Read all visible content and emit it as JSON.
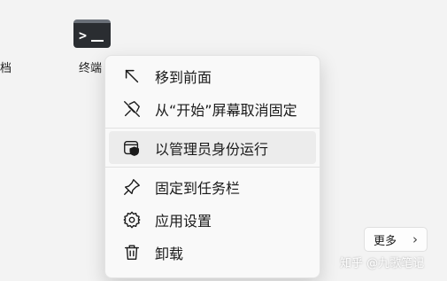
{
  "desktop": {
    "left_label": "档",
    "app": {
      "icon": "terminal-icon",
      "label": "终端"
    }
  },
  "context_menu": {
    "items": [
      {
        "id": "move-to-front",
        "label": "移到前面",
        "icon": "arrow-up-left-icon"
      },
      {
        "id": "unpin-from-start",
        "label": "从“开始”屏幕取消固定",
        "icon": "unpin-icon"
      },
      {
        "id": "run-as-admin",
        "label": "以管理员身份运行",
        "icon": "shield-window-icon",
        "highlighted": true
      },
      {
        "id": "pin-to-taskbar",
        "label": "固定到任务栏",
        "icon": "pin-icon"
      },
      {
        "id": "app-settings",
        "label": "应用设置",
        "icon": "gear-icon"
      },
      {
        "id": "uninstall",
        "label": "卸载",
        "icon": "trash-icon"
      }
    ]
  },
  "more_button": {
    "label": "更多",
    "icon": "chevron-right-icon"
  },
  "watermark": {
    "text": "知乎 @九歌笔记"
  },
  "colors": {
    "background": "#f3f3f3",
    "menu_background": "#f9f9f9",
    "highlight": "#ececec",
    "terminal_tile": "#2a2d31"
  }
}
